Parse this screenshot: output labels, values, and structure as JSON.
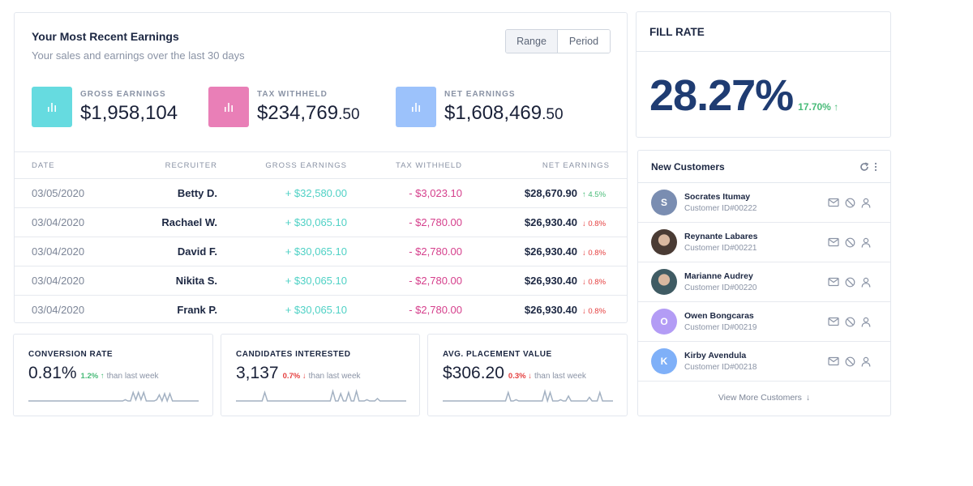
{
  "earnings": {
    "title": "Your Most Recent Earnings",
    "subtitle": "Your sales and earnings over the last 30 days",
    "toggle": {
      "range_label": "Range",
      "period_label": "Period",
      "active": "Range"
    },
    "stats": [
      {
        "label": "GROSS EARNINGS",
        "value": "$1,958,104",
        "cents": "",
        "icon": "bar-chart-icon",
        "color": "#66dbe0"
      },
      {
        "label": "TAX WITHHELD",
        "value": "$234,769",
        "cents": ".50",
        "icon": "bar-chart-icon",
        "color": "#e97fb7"
      },
      {
        "label": "NET EARNINGS",
        "value": "$1,608,469",
        "cents": ".50",
        "icon": "bar-chart-icon",
        "color": "#9cc2fb"
      }
    ],
    "table": {
      "headers": [
        "DATE",
        "RECRUITER",
        "GROSS EARNINGS",
        "TAX WITHHELD",
        "NET EARNINGS"
      ],
      "rows": [
        {
          "date": "03/05/2020",
          "recruiter": "Betty D.",
          "gross": "+ $32,580.00",
          "tax": "- $3,023.10",
          "net": "$28,670.90",
          "delta": "↑ 4.5%",
          "trend": "up"
        },
        {
          "date": "03/04/2020",
          "recruiter": "Rachael W.",
          "gross": "+ $30,065.10",
          "tax": "- $2,780.00",
          "net": "$26,930.40",
          "delta": "↓ 0.8%",
          "trend": "down"
        },
        {
          "date": "03/04/2020",
          "recruiter": "David F.",
          "gross": "+ $30,065.10",
          "tax": "- $2,780.00",
          "net": "$26,930.40",
          "delta": "↓ 0.8%",
          "trend": "down"
        },
        {
          "date": "03/04/2020",
          "recruiter": "Nikita S.",
          "gross": "+ $30,065.10",
          "tax": "- $2,780.00",
          "net": "$26,930.40",
          "delta": "↓ 0.8%",
          "trend": "down"
        },
        {
          "date": "03/04/2020",
          "recruiter": "Frank P.",
          "gross": "+ $30,065.10",
          "tax": "- $2,780.00",
          "net": "$26,930.40",
          "delta": "↓ 0.8%",
          "trend": "down"
        }
      ]
    }
  },
  "metrics": [
    {
      "label": "CONVERSION RATE",
      "value": "0.81%",
      "delta": "1.2% ↑",
      "trend": "up",
      "suffix": "than last week",
      "spark": [
        0,
        0,
        0,
        0,
        0,
        0,
        0,
        0,
        0,
        0,
        0,
        0,
        0,
        0,
        0,
        0,
        0,
        0,
        0,
        0,
        0,
        0,
        0,
        0,
        0,
        0,
        0,
        0,
        0,
        0,
        0,
        0,
        0,
        0,
        0,
        0,
        0,
        1,
        0,
        0,
        7,
        1,
        7,
        1,
        7,
        0,
        0,
        0,
        0,
        1,
        5,
        0,
        6,
        0,
        6,
        0,
        0,
        0,
        0,
        0,
        0,
        0,
        0,
        0,
        0,
        0
      ]
    },
    {
      "label": "CANDIDATES INTERESTED",
      "value": "3,137",
      "delta": "0.7% ↓",
      "trend": "down",
      "suffix": "than last week",
      "spark": [
        0,
        0,
        0,
        0,
        0,
        0,
        0,
        0,
        0,
        0,
        0,
        7,
        0,
        0,
        0,
        0,
        0,
        0,
        0,
        0,
        0,
        0,
        0,
        0,
        0,
        0,
        0,
        0,
        0,
        0,
        0,
        0,
        0,
        0,
        0,
        0,
        0,
        8,
        0,
        0,
        6,
        0,
        0,
        7,
        0,
        0,
        8,
        0,
        0,
        0,
        1,
        0,
        0,
        0,
        2,
        0,
        0,
        0,
        0,
        0,
        0,
        0,
        0,
        0,
        0,
        0
      ]
    },
    {
      "label": "AVG. PLACEMENT VALUE",
      "value": "$306.20",
      "delta": "0.3% ↓",
      "trend": "down",
      "suffix": "than last week",
      "spark": [
        0,
        0,
        0,
        0,
        0,
        0,
        0,
        0,
        0,
        0,
        0,
        0,
        0,
        0,
        0,
        0,
        0,
        0,
        0,
        0,
        0,
        0,
        0,
        0,
        0,
        7,
        0,
        0,
        1,
        0,
        0,
        0,
        0,
        0,
        0,
        0,
        0,
        0,
        0,
        8,
        0,
        7,
        0,
        0,
        0,
        1,
        0,
        0,
        4,
        0,
        0,
        0,
        0,
        0,
        0,
        0,
        3,
        0,
        0,
        0,
        7,
        0,
        0,
        0,
        0,
        0
      ]
    }
  ],
  "fill_rate": {
    "title": "FILL RATE",
    "value": "28.27%",
    "delta": "17.70% ↑",
    "trend": "up"
  },
  "customers": {
    "title": "New Customers",
    "items": [
      {
        "name": "Socrates Itumay",
        "id": "Customer ID#00222",
        "initial": "S",
        "avatar_color": "#7a8db1",
        "photo": false
      },
      {
        "name": "Reynante Labares",
        "id": "Customer ID#00221",
        "initial": "",
        "avatar_color": "#4a3b34",
        "photo": true
      },
      {
        "name": "Marianne Audrey",
        "id": "Customer ID#00220",
        "initial": "",
        "avatar_color": "#3f5b63",
        "photo": true
      },
      {
        "name": "Owen Bongcaras",
        "id": "Customer ID#00219",
        "initial": "O",
        "avatar_color": "#b39cf5",
        "photo": false
      },
      {
        "name": "Kirby Avendula",
        "id": "Customer ID#00218",
        "initial": "K",
        "avatar_color": "#7fb0f8",
        "photo": false
      }
    ],
    "view_more": "View More Customers",
    "view_more_icon": "↓"
  }
}
